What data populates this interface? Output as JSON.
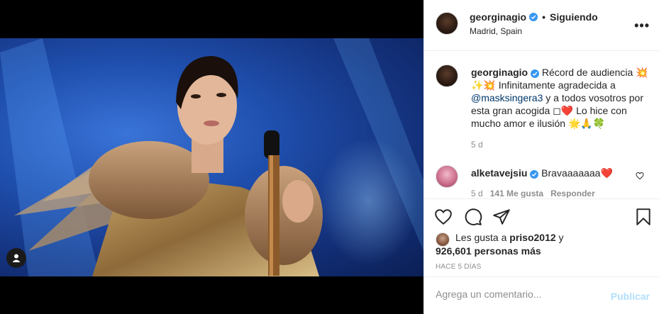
{
  "post": {
    "username": "georginagio",
    "follow_label": "Siguiendo",
    "separator": "•",
    "location": "Madrid, Spain",
    "more_label": "•••"
  },
  "caption": {
    "username": "georginagio",
    "text_1": "Récord de audiencia 💥✨💥 Infinitamente agradecida a ",
    "mention": "@masksingera3",
    "text_2": " y a todos vosotros por esta gran acogida ◻❤️ Lo hice con mucho amor e ilusión 🌟🙏🍀",
    "time": "5 d"
  },
  "comment": {
    "username": "alketavejsiu",
    "text": "Bravaaaaaaa❤️",
    "time": "5 d",
    "likes": "141 Me gusta",
    "reply_label": "Responder"
  },
  "likes": {
    "prefix": "Les gusta a ",
    "user": "priso2012",
    "conj": " y",
    "count": "926,601 personas más"
  },
  "ago": "HACE 5 DÍAS",
  "add_comment": {
    "placeholder": "Agrega un comentario...",
    "publish_label": "Publicar"
  },
  "icons": [
    "heart-icon",
    "comment-icon",
    "share-icon",
    "bookmark-icon",
    "more-icon",
    "verified-icon",
    "user-tag-icon"
  ],
  "colors": {
    "verified": "#3897f0",
    "publish_disabled": "#b2dffc",
    "muted": "#8e8e8e"
  }
}
